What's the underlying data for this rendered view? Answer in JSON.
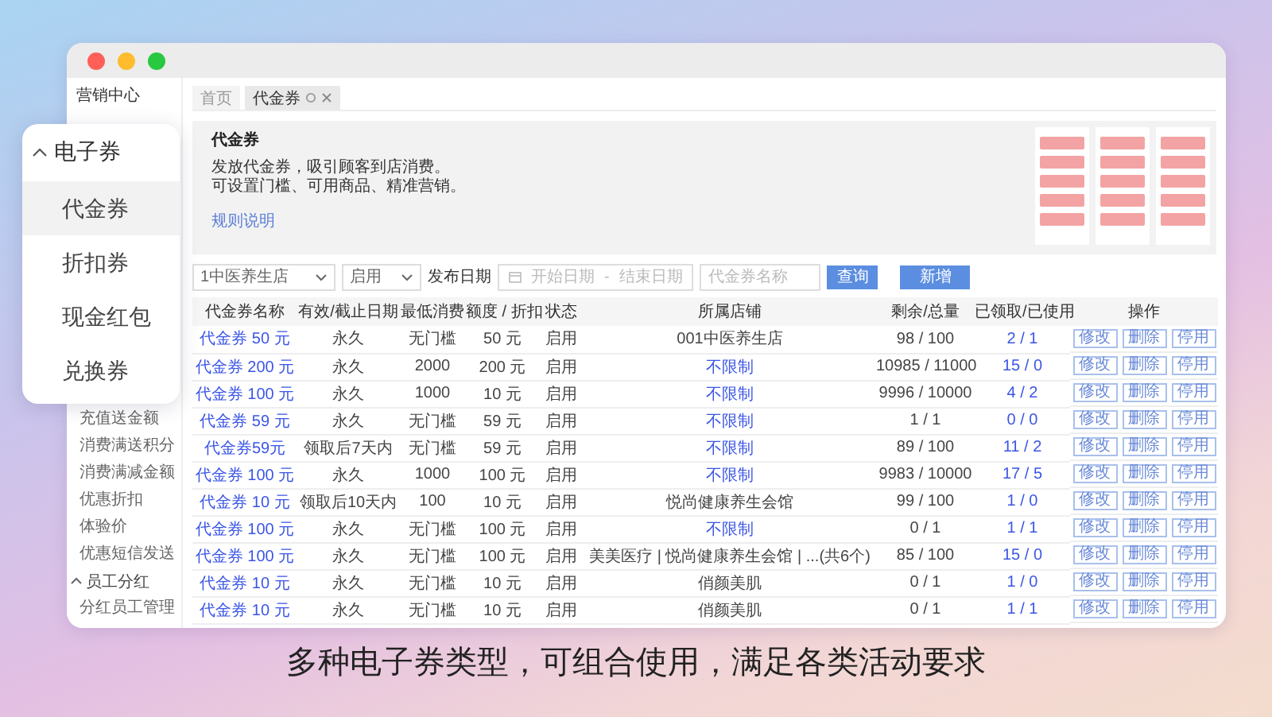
{
  "window": {
    "title": "营销中心"
  },
  "sidebar": {
    "items": [
      {
        "label": "充值送金额"
      },
      {
        "label": "消费满送积分"
      },
      {
        "label": "消费满减金额"
      },
      {
        "label": "优惠折扣"
      },
      {
        "label": "体验价"
      },
      {
        "label": "优惠短信发送"
      },
      {
        "label": "员工分红",
        "expanded": true,
        "children": [
          {
            "label": "分红员工管理"
          }
        ]
      }
    ]
  },
  "popup_menu": {
    "title": "电子券",
    "expanded": true,
    "items": [
      {
        "label": "代金券",
        "selected": true
      },
      {
        "label": "折扣券",
        "selected": false
      },
      {
        "label": "现金红包",
        "selected": false
      },
      {
        "label": "兑换券",
        "selected": false
      }
    ]
  },
  "tabs": [
    {
      "label": "首页",
      "selected": false,
      "closable": false
    },
    {
      "label": "代金券",
      "selected": true,
      "closable": true
    }
  ],
  "intro": {
    "title": "代金券",
    "lines": [
      "发放代金券，吸引顾客到店消费。",
      "可设置门槛、可用商品、精准营销。"
    ],
    "link": "规则说明"
  },
  "filters": {
    "store": "1中医养生店",
    "status": "启用",
    "date_label": "发布日期",
    "date_start_placeholder": "开始日期",
    "date_separator": "-",
    "date_end_placeholder": "结束日期",
    "name_placeholder": "代金券名称",
    "buttons": [
      "查询",
      "新增"
    ]
  },
  "table": {
    "columns": [
      "代金券名称",
      "有效/截止日期",
      "最低消费",
      "额度 / 折扣",
      "状态",
      "所属店铺",
      "剩余/总量",
      "已领取/已使用",
      "操作"
    ],
    "rows": [
      {
        "cells": [
          "代金券 50 元",
          "永久",
          "无门槛",
          "50 元",
          "启用",
          "001中医养生店",
          "98 / 100",
          "2 / 1"
        ],
        "store_is_link": false,
        "actions": [
          "修改",
          "删除",
          "停用"
        ]
      },
      {
        "cells": [
          "代金券 200 元",
          "永久",
          "2000",
          "200 元",
          "启用",
          "不限制",
          "10985 / 11000",
          "15 / 0"
        ],
        "store_is_link": true,
        "actions": [
          "修改",
          "删除",
          "停用"
        ]
      },
      {
        "cells": [
          "代金券 100 元",
          "永久",
          "1000",
          "10 元",
          "启用",
          "不限制",
          "9996 / 10000",
          "4 / 2"
        ],
        "store_is_link": true,
        "actions": [
          "修改",
          "删除",
          "停用"
        ]
      },
      {
        "cells": [
          "代金券 59 元",
          "永久",
          "无门槛",
          "59 元",
          "启用",
          "不限制",
          "1 / 1",
          "0 / 0"
        ],
        "store_is_link": true,
        "actions": [
          "修改",
          "删除",
          "停用"
        ]
      },
      {
        "cells": [
          "代金券59元",
          "领取后7天内",
          "无门槛",
          "59 元",
          "启用",
          "不限制",
          "89 / 100",
          "11 / 2"
        ],
        "store_is_link": true,
        "actions": [
          "修改",
          "删除",
          "停用"
        ]
      },
      {
        "cells": [
          "代金券 100 元",
          "永久",
          "1000",
          "100 元",
          "启用",
          "不限制",
          "9983 / 10000",
          "17 / 5"
        ],
        "store_is_link": true,
        "actions": [
          "修改",
          "删除",
          "停用"
        ]
      },
      {
        "cells": [
          "代金券 10 元",
          "领取后10天内",
          "100",
          "10 元",
          "启用",
          "悦尚健康养生会馆",
          "99 / 100",
          "1 / 0"
        ],
        "store_is_link": false,
        "actions": [
          "修改",
          "删除",
          "停用"
        ]
      },
      {
        "cells": [
          "代金券 100 元",
          "永久",
          "无门槛",
          "100 元",
          "启用",
          "不限制",
          "0 / 1",
          "1 / 1"
        ],
        "store_is_link": true,
        "actions": [
          "修改",
          "删除",
          "停用"
        ]
      },
      {
        "cells": [
          "代金券 100 元",
          "永久",
          "无门槛",
          "100 元",
          "启用",
          "美美医疗 | 悦尚健康养生会馆 | ...(共6个)",
          "85 / 100",
          "15 / 0"
        ],
        "store_is_link": false,
        "actions": [
          "修改",
          "删除",
          "停用"
        ]
      },
      {
        "cells": [
          "代金券 10 元",
          "永久",
          "无门槛",
          "10 元",
          "启用",
          "俏颜美肌",
          "0 / 1",
          "1 / 0"
        ],
        "store_is_link": false,
        "actions": [
          "修改",
          "删除",
          "停用"
        ]
      },
      {
        "cells": [
          "代金券 10 元",
          "永久",
          "无门槛",
          "10 元",
          "启用",
          "俏颜美肌",
          "0 / 1",
          "1 / 1"
        ],
        "store_is_link": false,
        "actions": [
          "修改",
          "删除",
          "停用"
        ]
      }
    ]
  },
  "caption": "多种电子券类型，可组合使用，满足各类活动要求"
}
